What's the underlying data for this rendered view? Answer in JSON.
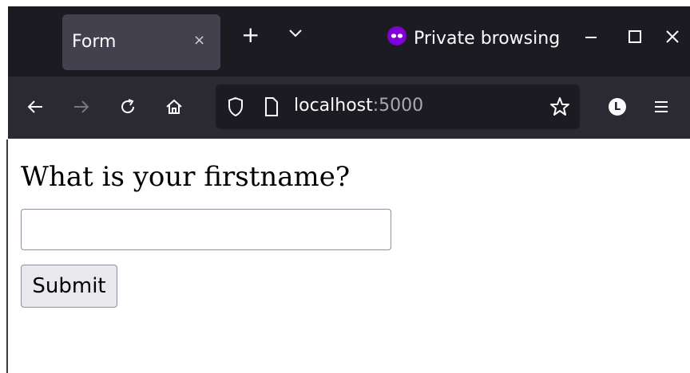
{
  "tab": {
    "title": "Form",
    "close_glyph": "×"
  },
  "toolbar": {
    "new_tab_glyph": "+",
    "private_label": "Private browsing"
  },
  "url": {
    "host": "localhost",
    "port": ":5000"
  },
  "account": {
    "initial": "L"
  },
  "page": {
    "question": "What is your firstname?",
    "firstname_value": "",
    "submit_label": "Submit"
  },
  "colors": {
    "tabbar_bg": "#1c1b22",
    "navbar_bg": "#2b2a33",
    "private_accent": "#8000d7"
  },
  "icons": [
    "close-icon",
    "plus-icon",
    "chevron-down-icon",
    "private-mask-icon",
    "minimize-icon",
    "maximize-icon",
    "close-window-icon",
    "back-arrow-icon",
    "forward-arrow-icon",
    "reload-icon",
    "home-icon",
    "shield-icon",
    "page-icon",
    "star-icon",
    "account-icon",
    "menu-icon"
  ]
}
